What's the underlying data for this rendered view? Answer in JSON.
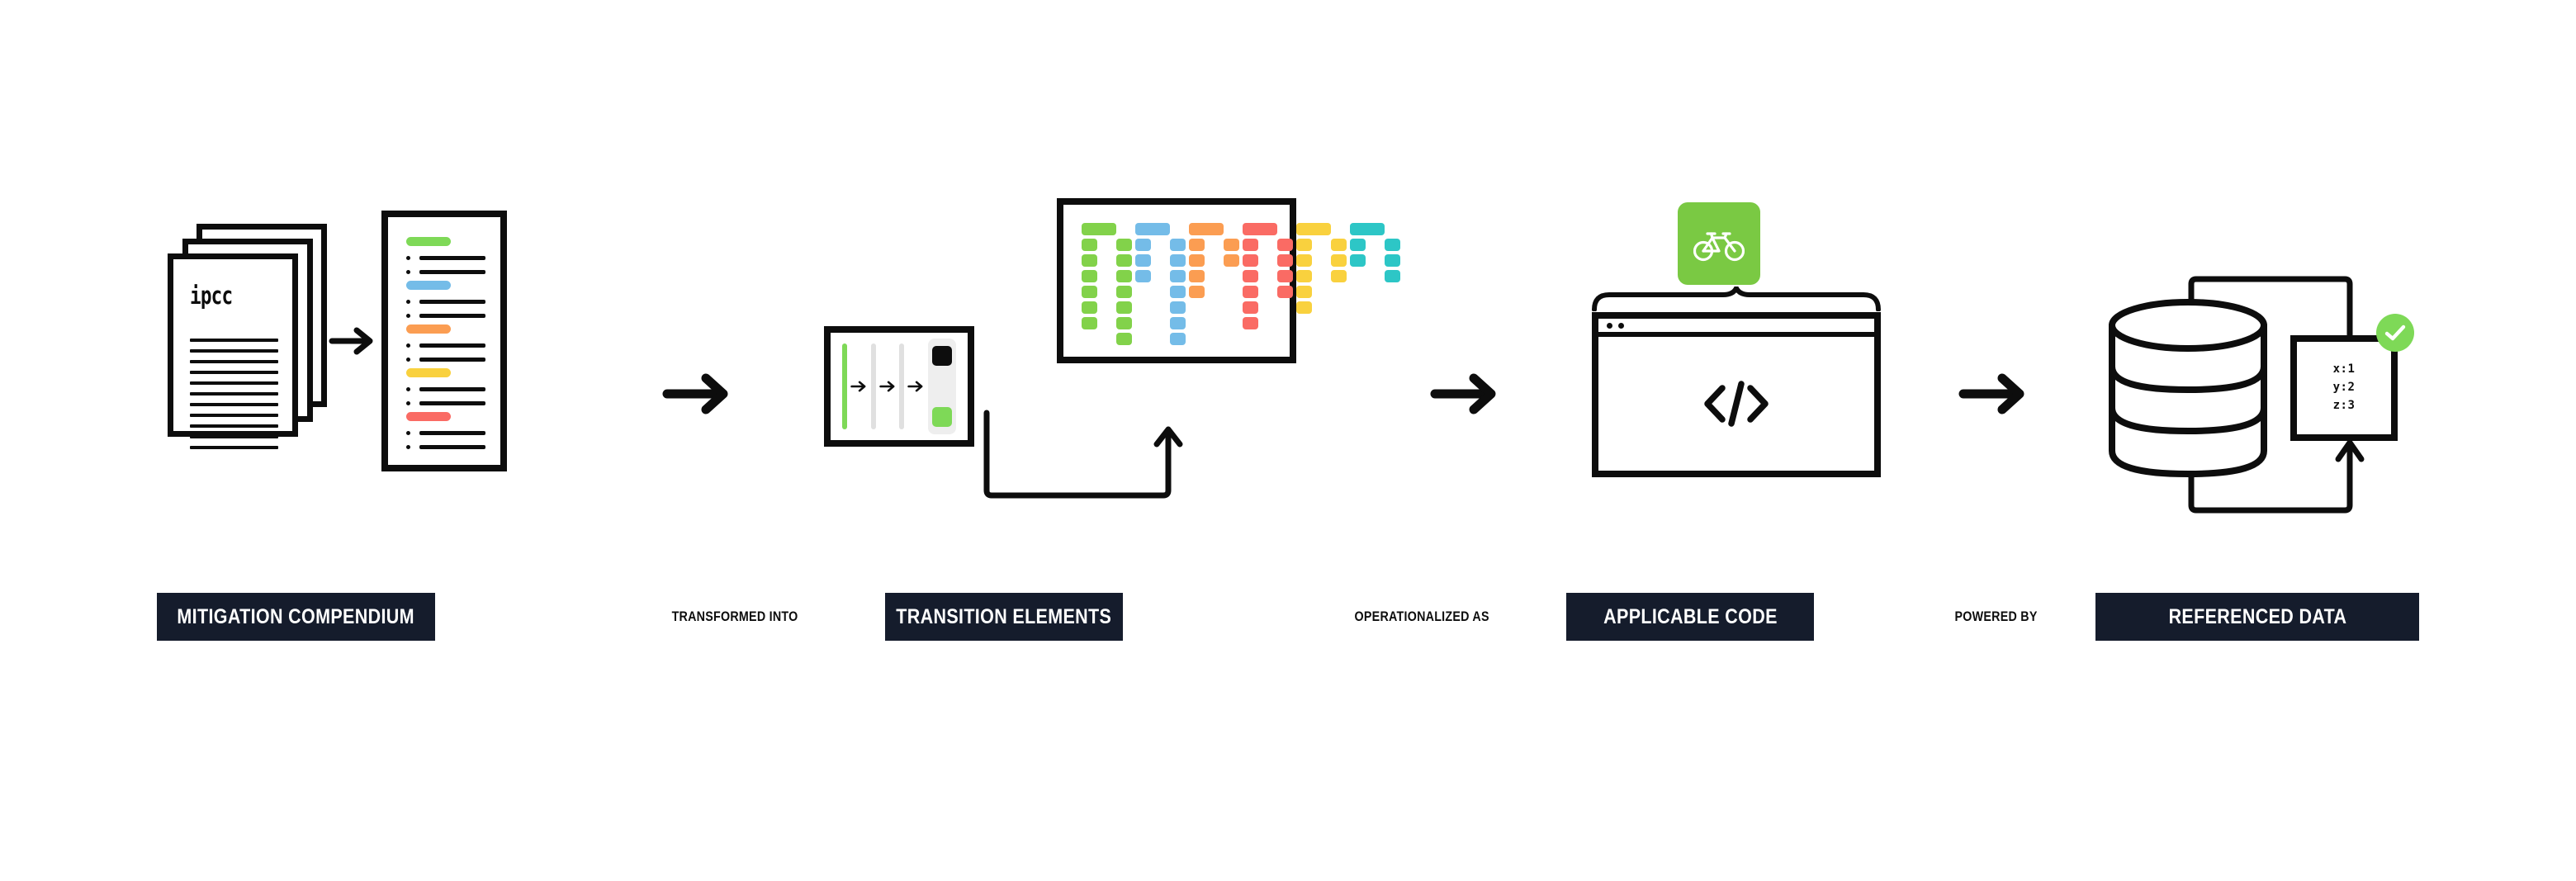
{
  "diagram": {
    "title": "Mitigation compendium to referenced data pipeline",
    "colors": {
      "ink": "#0d0d0d",
      "chip_bg": "#151c2c",
      "green": "#7ed957",
      "grid_green": "#82d24a",
      "blue": "#74bce8",
      "orange": "#fb9d52",
      "red": "#fa6b64",
      "yellow": "#f9d13e",
      "teal": "#2dc6c6",
      "gray_bar": "#e0e0e0",
      "panel_gray": "#eeeeee",
      "tile_green": "#7ac943",
      "check_green": "#7ed957"
    }
  },
  "labels": {
    "chips": [
      {
        "id": "mitigation-compendium",
        "text": "MITIGATION COMPENDIUM"
      },
      {
        "id": "transition-elements",
        "text": "TRANSITION ELEMENTS"
      },
      {
        "id": "applicable-code",
        "text": "APPLICABLE CODE"
      },
      {
        "id": "referenced-data",
        "text": "REFERENCED DATA"
      }
    ],
    "connectors": [
      {
        "id": "transformed-into",
        "text": "TRANSFORMED INTO"
      },
      {
        "id": "operationalized-as",
        "text": "OPERATIONALIZED AS"
      },
      {
        "id": "powered-by",
        "text": "POWERED BY"
      }
    ]
  },
  "stage1": {
    "icon_name": "document-stack-icon",
    "source_mark": "ipcc",
    "stack_sheets": 3,
    "body_line_count": 11,
    "annotated_doc": {
      "icon_name": "annotated-document-icon",
      "sections": [
        {
          "color": "#7ed957",
          "bullets": 2
        },
        {
          "color": "#74bce8",
          "bullets": 2
        },
        {
          "color": "#fb9d52",
          "bullets": 2
        },
        {
          "color": "#f9d13e",
          "bullets": 2
        },
        {
          "color": "#fa6b64",
          "bullets": 2
        }
      ]
    }
  },
  "stage2": {
    "slider_panel": {
      "icon_name": "timeline-slider-panel",
      "bars": [
        "#7ed957",
        "#e0e0e0",
        "#e0e0e0"
      ],
      "arrow_count": 3,
      "swatches": [
        "#0d0d0d",
        "#7ed957"
      ]
    },
    "heatmap": {
      "icon_name": "category-heatmap-grid",
      "columns": 12,
      "rows": 8,
      "group_colors": [
        "#82d24a",
        "#74bce8",
        "#fb9d52",
        "#fa6b64",
        "#f9d13e",
        "#2dc6c6"
      ],
      "col_heights": [
        7,
        8,
        4,
        8,
        5,
        3,
        7,
        5,
        6,
        4,
        3,
        4
      ],
      "top_wide_row": true
    }
  },
  "stage3": {
    "app_tile": {
      "icon_name": "bicycle-icon",
      "bg": "#7ac943"
    },
    "browser": {
      "icon_name": "browser-window-icon",
      "title_dots": 2,
      "content_glyph": "</>"
    }
  },
  "stage4": {
    "database": {
      "icon_name": "database-cylinder-icon",
      "bands": 3
    },
    "data_card": {
      "icon_name": "data-record-card",
      "rows": [
        "x:1",
        "y:2",
        "z:3"
      ]
    },
    "status": {
      "icon_name": "check-circle-icon",
      "color": "#7ed957"
    }
  }
}
